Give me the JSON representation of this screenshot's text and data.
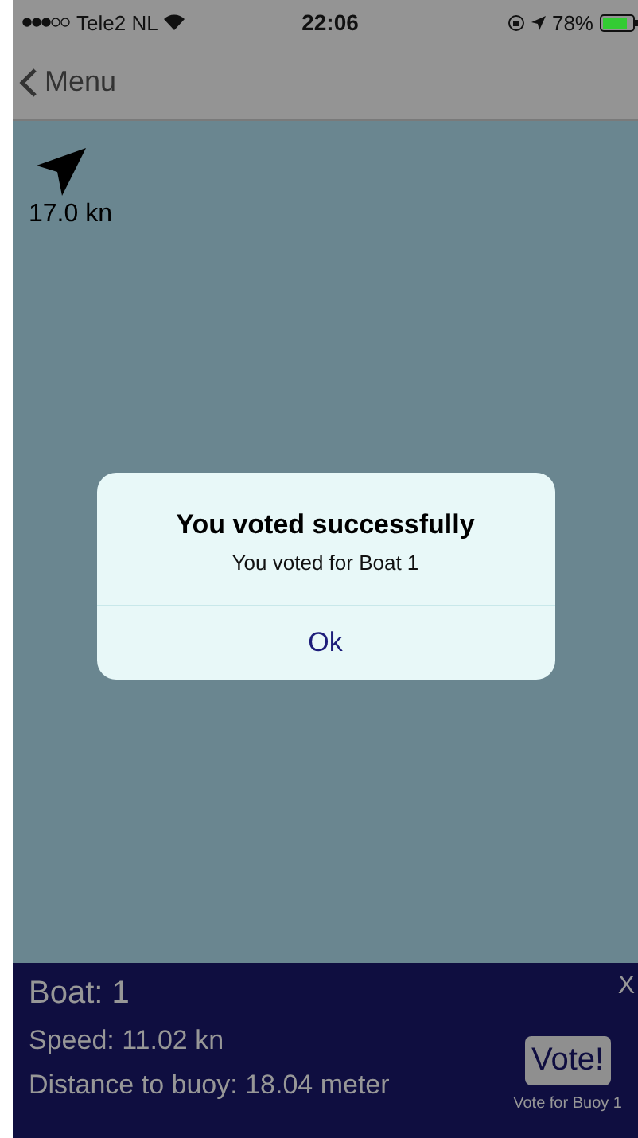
{
  "status_bar": {
    "carrier": "Tele2 NL",
    "time": "22:06",
    "battery": "78%"
  },
  "nav": {
    "back": "Menu"
  },
  "map": {
    "speed": "17.0 kn"
  },
  "info_panel": {
    "boat": "Boat: 1",
    "speed": "Speed: 11.02 kn",
    "distance": "Distance to buoy: 18.04 meter",
    "close": "X",
    "vote_button": "Vote!",
    "vote_caption": "Vote for Buoy 1"
  },
  "dialog": {
    "title": "You voted successfully",
    "message": "You voted for Boat 1",
    "buttons": [
      "Ok"
    ]
  }
}
